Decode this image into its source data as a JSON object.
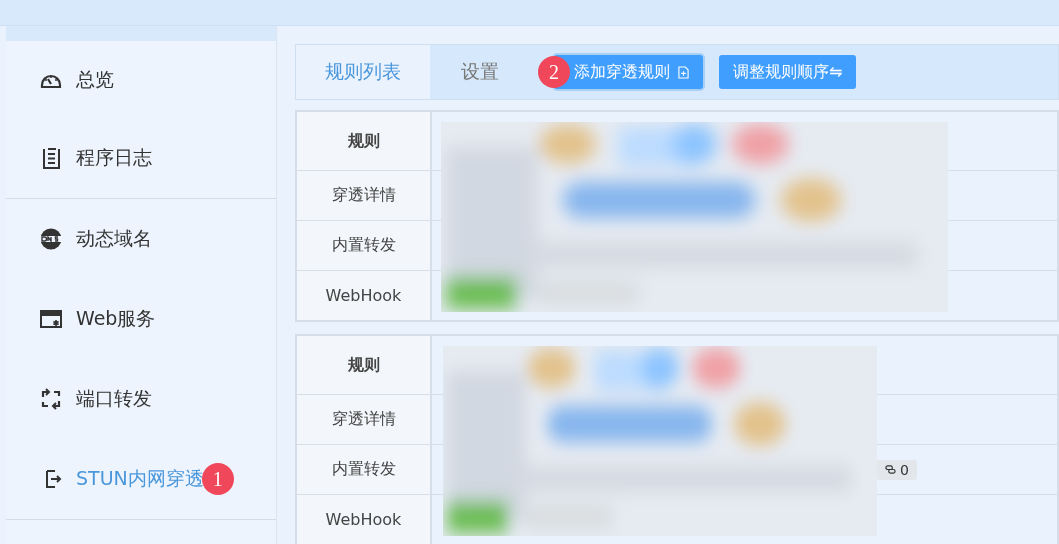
{
  "sidebar": {
    "groups": [
      [
        {
          "label": "总览",
          "selected": false
        },
        {
          "label": "程序日志",
          "selected": false
        }
      ],
      [
        {
          "label": "动态域名",
          "selected": false
        },
        {
          "label": "Web服务",
          "selected": false
        },
        {
          "label": "端口转发",
          "selected": false
        },
        {
          "label": "STUN内网穿透",
          "selected": true,
          "badge": "1"
        }
      ]
    ]
  },
  "tabs": [
    {
      "label": "规则列表",
      "selected": true
    },
    {
      "label": "设置",
      "selected": false
    }
  ],
  "buttons": [
    {
      "label": "添加穿透规则",
      "kind": "add",
      "badge": "2",
      "focused": true
    },
    {
      "label": "调整规则顺序⇋",
      "kind": "reorder",
      "focused": false
    }
  ],
  "rules": [
    {
      "rows": [
        {
          "label": "规则"
        },
        {
          "label": "穿透详情"
        },
        {
          "label": "内置转发"
        },
        {
          "label": "WebHook"
        }
      ]
    },
    {
      "rows": [
        {
          "label": "规则"
        },
        {
          "label": "穿透详情"
        },
        {
          "label": "内置转发",
          "link_count": "0"
        },
        {
          "label": "WebHook"
        }
      ]
    }
  ]
}
